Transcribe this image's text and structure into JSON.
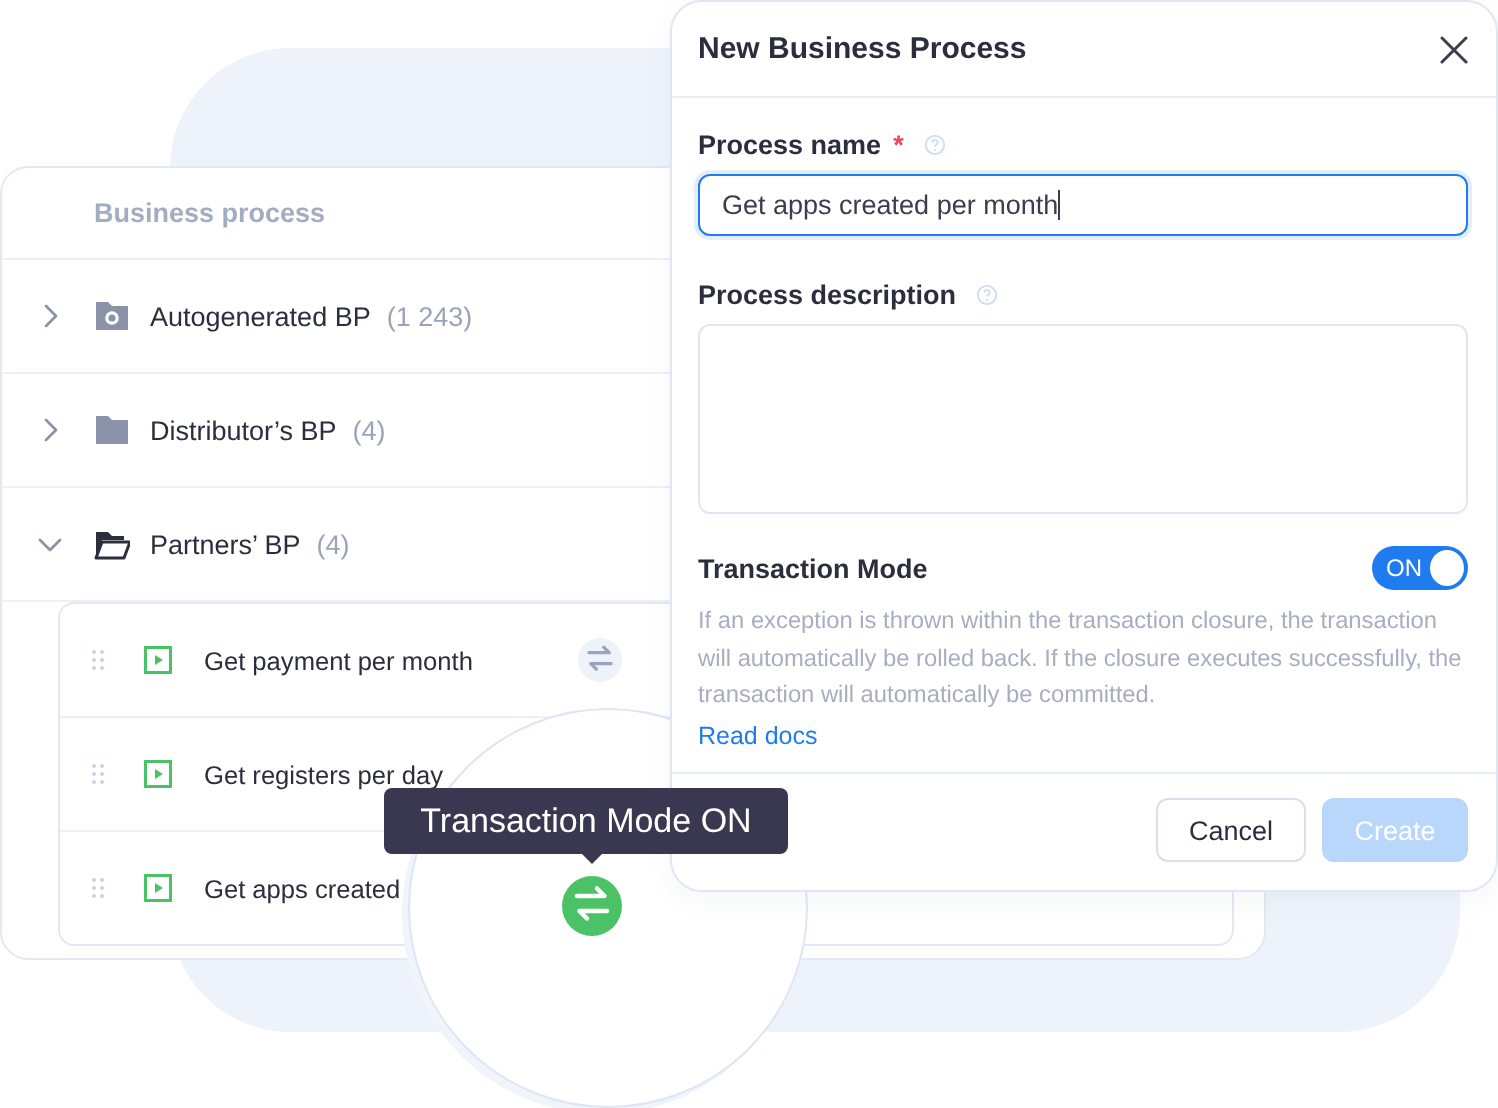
{
  "tree_panel": {
    "header": "Business process",
    "folders": [
      {
        "kind": "generated",
        "name": "Autogenerated BP",
        "count": "(1 243)",
        "expanded": false
      },
      {
        "kind": "plain",
        "name": "Distributor’s BP",
        "count": "(4)",
        "expanded": false
      },
      {
        "kind": "plain",
        "name": "Partners’ BP",
        "count": "(4)",
        "expanded": true,
        "children": [
          {
            "name": "Get payment per month",
            "transaction_mode": true
          },
          {
            "name": "Get registers per day"
          },
          {
            "name": "Get apps created"
          }
        ]
      }
    ]
  },
  "dialog": {
    "title": "New Business Process",
    "name_field": {
      "label": "Process name",
      "required_mark": "*",
      "value": "Get apps created per month",
      "focused": true
    },
    "description_field": {
      "label": "Process description"
    },
    "transaction": {
      "label": "Transaction Mode",
      "on": true,
      "state_label": "ON",
      "description": "If an exception is thrown within the transaction closure, the transaction will automatically be rolled back. If the closure executes successfully, the transaction will automatically be committed.",
      "link": "Read docs"
    },
    "buttons": [
      {
        "label": "Cancel",
        "kind": "secondary",
        "disabled": false
      },
      {
        "label": "Create",
        "kind": "primary",
        "disabled": true
      }
    ]
  },
  "lens": {
    "tooltip": "Transaction Mode ON",
    "transaction_mode": true
  }
}
